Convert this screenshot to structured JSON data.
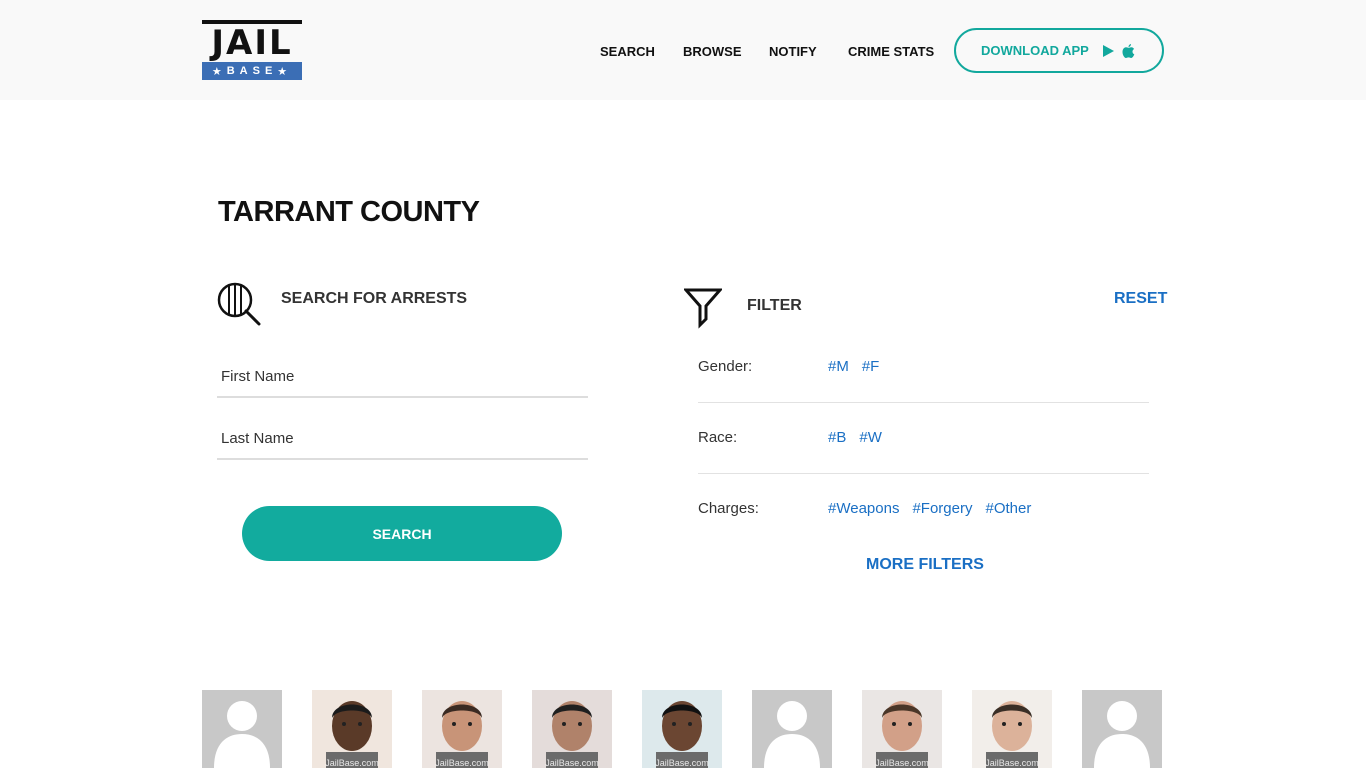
{
  "header": {
    "logo_top": "JAIL",
    "logo_bottom": "BASE",
    "nav": [
      "SEARCH",
      "BROWSE",
      "NOTIFY",
      "CRIME STATS"
    ],
    "download_label": "DOWNLOAD APP"
  },
  "page": {
    "title": "TARRANT COUNTY"
  },
  "search": {
    "heading": "SEARCH FOR ARRESTS",
    "first_name_placeholder": "First Name",
    "last_name_placeholder": "Last Name",
    "button_label": "SEARCH"
  },
  "filter": {
    "heading": "FILTER",
    "reset_label": "RESET",
    "rows": [
      {
        "label": "Gender:",
        "tags": [
          "#M",
          "#F"
        ]
      },
      {
        "label": "Race:",
        "tags": [
          "#B",
          "#W"
        ]
      },
      {
        "label": "Charges:",
        "tags": [
          "#Weapons",
          "#Forgery",
          "#Other"
        ]
      }
    ],
    "more_label": "MORE FILTERS"
  },
  "mugshots": {
    "watermark": "JailBase.com",
    "items": [
      {
        "kind": "silhouette"
      },
      {
        "kind": "photo"
      },
      {
        "kind": "photo"
      },
      {
        "kind": "photo"
      },
      {
        "kind": "photo"
      },
      {
        "kind": "silhouette"
      },
      {
        "kind": "photo"
      },
      {
        "kind": "photo"
      },
      {
        "kind": "silhouette"
      }
    ]
  },
  "colors": {
    "accent": "#12ab9e",
    "link": "#1a6fc4",
    "logo_blue": "#3b6eb5"
  }
}
